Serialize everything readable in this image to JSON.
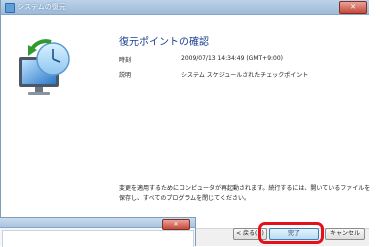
{
  "window": {
    "title": "システムの復元",
    "close_glyph": "✕"
  },
  "confirm": {
    "heading": "復元ポイントの確認",
    "time_label": "時刻",
    "time_value": "2009/07/13 14:34:49 (GMT+9:00)",
    "desc_label": "説明",
    "desc_value": "システム スケジュールされたチェックポイント"
  },
  "notice": {
    "line1": "変更を適用するためにコンピュータが再起動されます。続行するには、開いているファイルを",
    "line2": "保存し、すべてのプログラムを閉じてください。"
  },
  "buttons": {
    "back": "< 戻る(B)",
    "finish": "完了",
    "cancel": "キャンセル"
  },
  "background_window": {
    "close_glyph": "✕"
  },
  "colors": {
    "highlight": "#e4101a",
    "heading": "#1b3f8f",
    "close_button": "#c44a3a"
  }
}
